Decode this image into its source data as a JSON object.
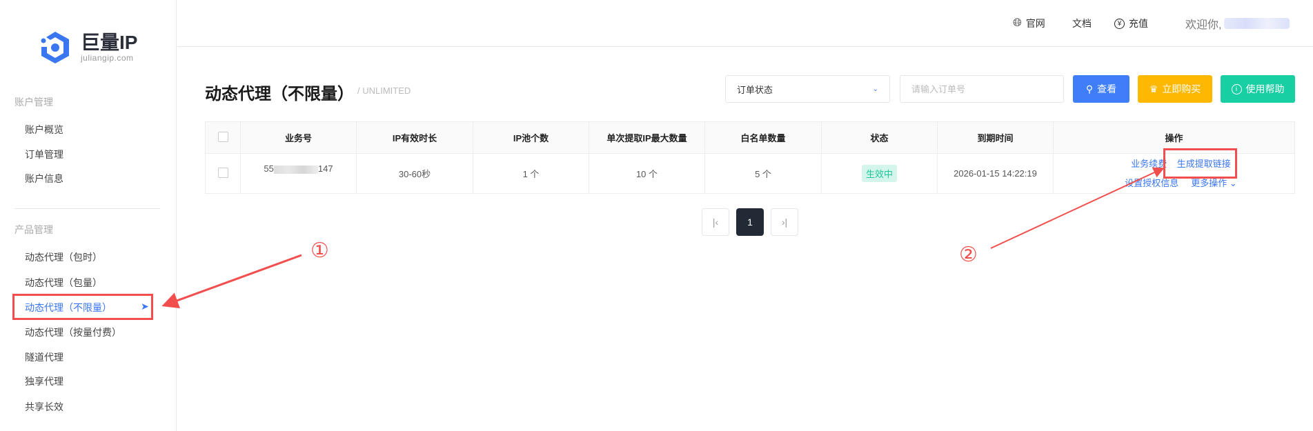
{
  "brand": {
    "name": "巨量IP",
    "url": "juliangip.com",
    "color": "#3a76f0"
  },
  "sidebar": {
    "sections": [
      {
        "label": "账户管理",
        "items": [
          {
            "label": "账户概览"
          },
          {
            "label": "订单管理"
          },
          {
            "label": "账户信息"
          }
        ]
      },
      {
        "label": "产品管理",
        "items": [
          {
            "label": "动态代理（包时）"
          },
          {
            "label": "动态代理（包量）"
          },
          {
            "label": "动态代理（不限量）",
            "active": true
          },
          {
            "label": "动态代理（按量付费）"
          },
          {
            "label": "隧道代理"
          },
          {
            "label": "独享代理"
          },
          {
            "label": "共享长效"
          }
        ]
      }
    ]
  },
  "topbar": {
    "website": "官网",
    "docs": "文档",
    "recharge": "充值",
    "welcome": "欢迎你,"
  },
  "page": {
    "title": "动态代理（不限量）",
    "subtitle": "/ UNLIMITED"
  },
  "filters": {
    "status_select": "订单状态",
    "order_placeholder": "请输入订单号",
    "search_label": "查看",
    "buy_label": "立即购买",
    "help_label": "使用帮助"
  },
  "table": {
    "headers": [
      "业务号",
      "IP有效时长",
      "IP池个数",
      "单次提取IP最大数量",
      "白名单数量",
      "状态",
      "到期时间",
      "操作"
    ],
    "rows": [
      {
        "id_prefix": "55",
        "id_suffix": "147",
        "duration": "30-60秒",
        "pool": "1 个",
        "max": "10 个",
        "whitelist": "5 个",
        "status": "生效中",
        "expire": "2026-01-15 14:22:19",
        "actions": {
          "renew": "业务续费",
          "gen_link": "生成提取链接",
          "auth": "设置授权信息",
          "more": "更多操作"
        }
      }
    ]
  },
  "pagination": {
    "current": "1"
  },
  "annotations": {
    "step1": "①",
    "step2": "②",
    "color": "#f24e4e"
  }
}
